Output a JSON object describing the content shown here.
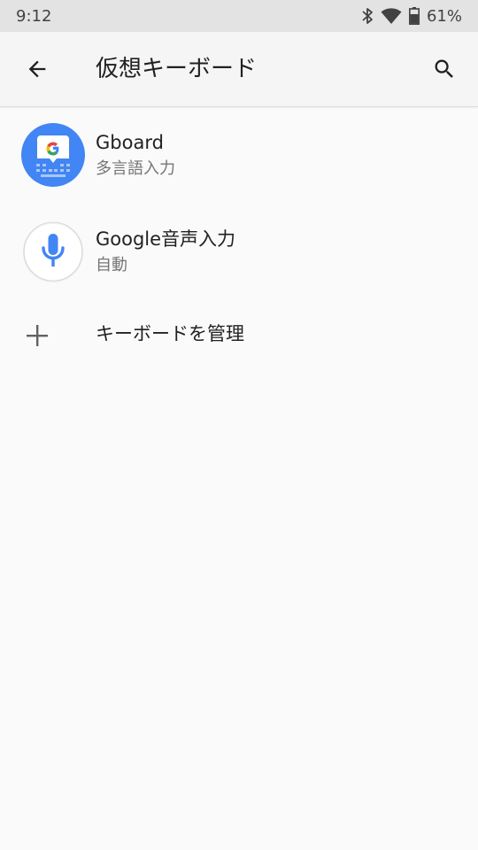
{
  "status_bar": {
    "time": "9:12",
    "battery": "61%",
    "icons": [
      "bluetooth-icon",
      "wifi-icon",
      "battery-icon"
    ]
  },
  "app_bar": {
    "title": "仮想キーボード",
    "icons": [
      "back-arrow-icon",
      "search-icon"
    ]
  },
  "keyboards": [
    {
      "name": "Gboard",
      "subtitle": "多言語入力",
      "icon": "gboard-icon"
    },
    {
      "name": "Google音声入力",
      "subtitle": "自動",
      "icon": "microphone-icon"
    }
  ],
  "manage": {
    "label": "キーボードを管理",
    "icon": "plus-icon"
  },
  "colors": {
    "status_bar": "#e3e3e3",
    "app_bar": "#f5f5f5",
    "background": "#fafafa",
    "gboard_blue": "#4285f4",
    "mic_blue": "#4285f4",
    "secondary_text": "#757575"
  }
}
